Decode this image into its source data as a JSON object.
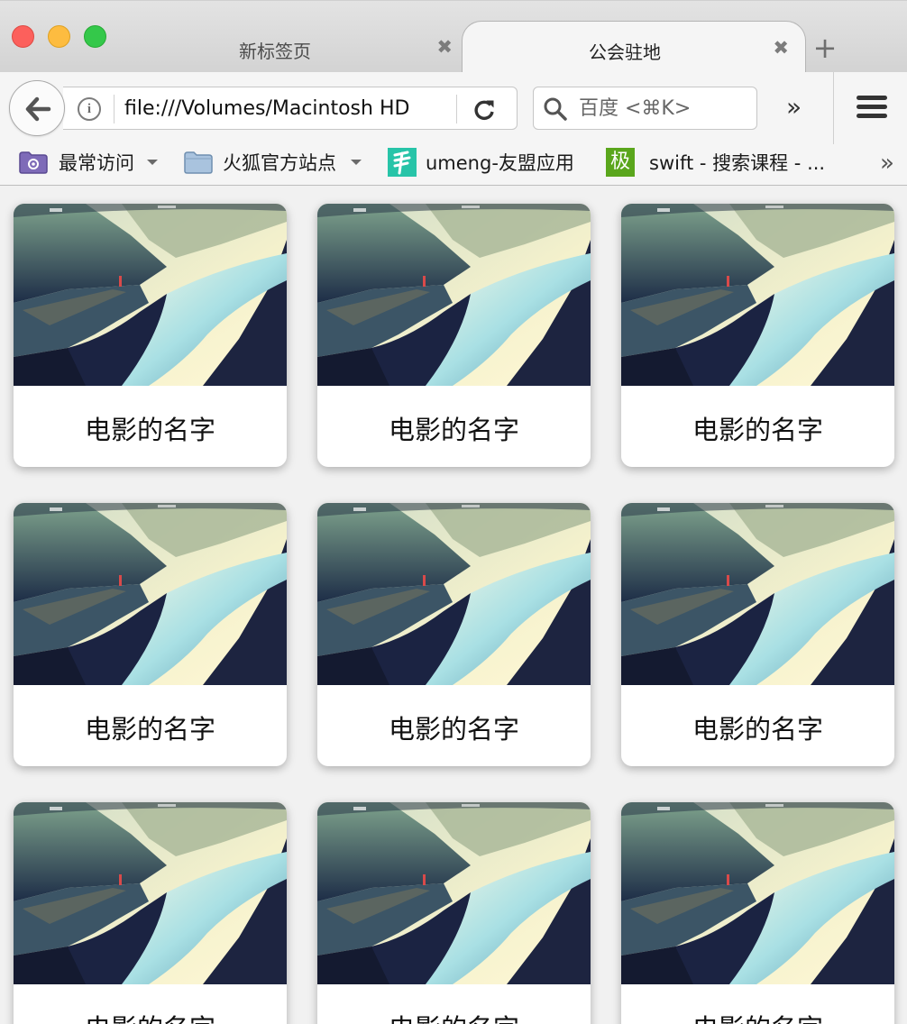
{
  "window": {
    "tabs": [
      {
        "title": "新标签页",
        "close_glyph": "✖",
        "active": false
      },
      {
        "title": "公会驻地",
        "close_glyph": "✖",
        "active": true
      }
    ],
    "new_tab_glyph": "+"
  },
  "toolbar": {
    "url": "file:///Volumes/Macintosh HD",
    "search_placeholder": "百度 <⌘K>",
    "overflow_glyph": "»"
  },
  "bookmarks": {
    "items": [
      {
        "label": "最常访问",
        "icon": "folder-smart-icon",
        "has_dropdown": true
      },
      {
        "label": "火狐官方站点",
        "icon": "folder-icon",
        "has_dropdown": true
      },
      {
        "label": "umeng-友盟应用",
        "icon": "umeng-favicon",
        "has_dropdown": false
      },
      {
        "label": "swift - 搜索课程 - ...",
        "icon": "kuang-favicon",
        "has_dropdown": false
      }
    ],
    "overflow_glyph": "»",
    "kuang_glyph": "极"
  },
  "cards": [
    {
      "title": "电影的名字"
    },
    {
      "title": "电影的名字"
    },
    {
      "title": "电影的名字"
    },
    {
      "title": "电影的名字"
    },
    {
      "title": "电影的名字"
    },
    {
      "title": "电影的名字"
    },
    {
      "title": "电影的名字"
    },
    {
      "title": "电影的名字"
    },
    {
      "title": "电影的名字"
    }
  ],
  "colors": {
    "close": "#fc605c",
    "minimize": "#fdbc40",
    "maximize": "#34c84a",
    "card_background": "#ffffff",
    "page_background": "#f1f1f1"
  }
}
